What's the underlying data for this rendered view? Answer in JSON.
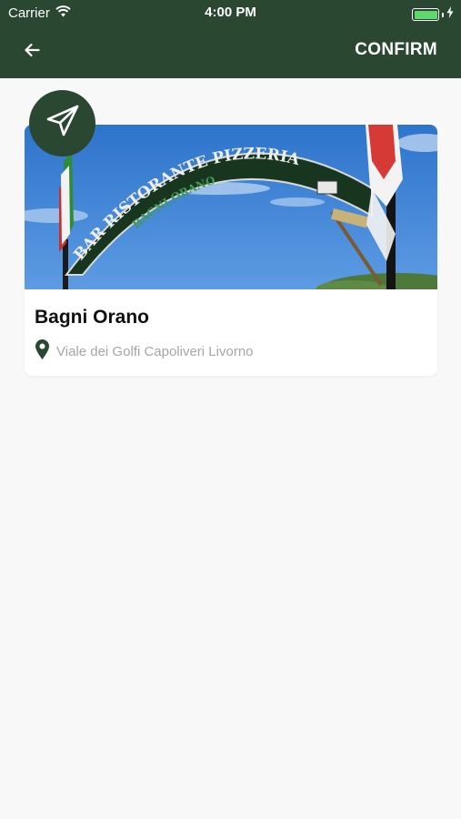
{
  "status_bar": {
    "carrier": "Carrier",
    "time": "4:00 PM",
    "battery_level": 1.0
  },
  "nav": {
    "back_icon": "arrow-left-icon",
    "confirm_label": "CONFIRM"
  },
  "fab": {
    "icon": "paper-plane-icon"
  },
  "card": {
    "image_sign_text": "BAR RISTORANTE PIZZERIA",
    "image_sign_subtext": "BAGNI ORANO",
    "title": "Bagni Orano",
    "location_icon": "map-pin-icon",
    "address": "Viale dei Golfi Capoliveri Livorno"
  },
  "colors": {
    "primary": "#2a4732",
    "background": "#f8f8f8",
    "address_text": "#a6a6a6",
    "battery": "#5ed86a"
  }
}
